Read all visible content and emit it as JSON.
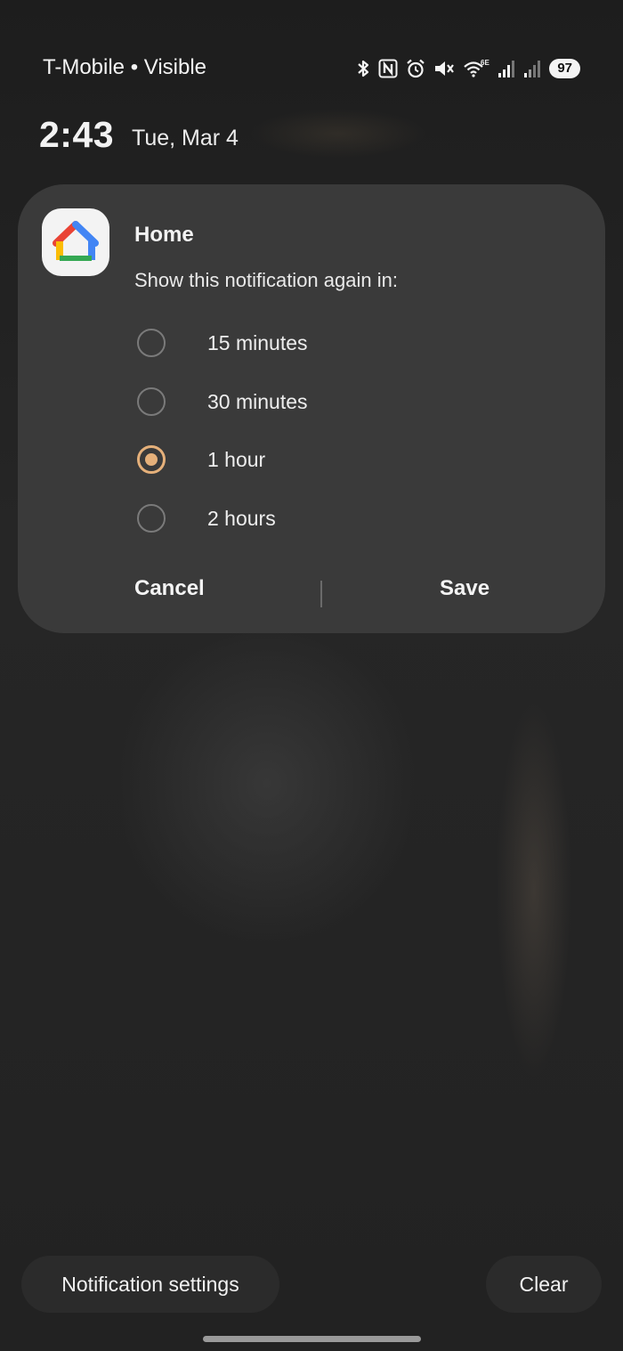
{
  "status_bar": {
    "carrier": "T-Mobile • Visible",
    "battery": "97",
    "icons": [
      "bluetooth-icon",
      "nfc-icon",
      "alarm-icon",
      "mute-icon",
      "wifi-6e-icon",
      "signal-icon",
      "signal-icon"
    ]
  },
  "lockscreen": {
    "time": "2:43",
    "date": "Tue, Mar 4"
  },
  "snooze_card": {
    "app_name": "Home",
    "app_icon": "google-home-icon",
    "prompt": "Show this notification again in:",
    "options": [
      {
        "label": "15 minutes",
        "selected": false
      },
      {
        "label": "30 minutes",
        "selected": false
      },
      {
        "label": "1 hour",
        "selected": true
      },
      {
        "label": "2 hours",
        "selected": false
      }
    ],
    "cancel_label": "Cancel",
    "save_label": "Save",
    "accent_color": "#e5b07a"
  },
  "bottom": {
    "notification_settings_label": "Notification settings",
    "clear_label": "Clear"
  }
}
